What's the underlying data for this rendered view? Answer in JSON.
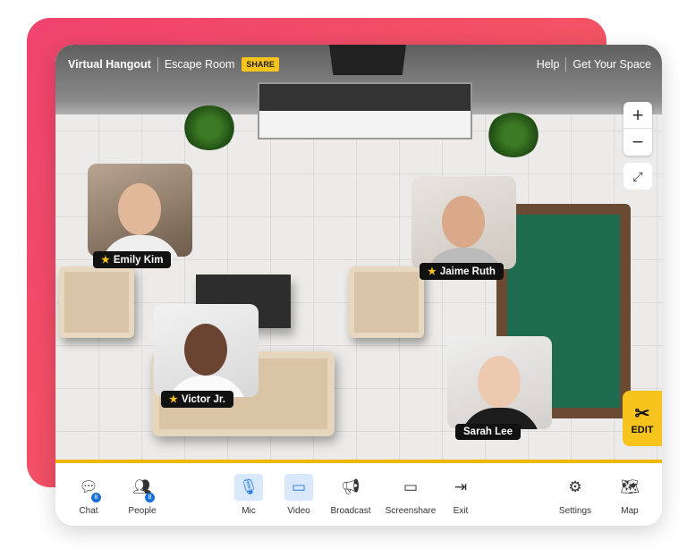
{
  "header": {
    "app_title": "Virtual Hangout",
    "room_name": "Escape Room",
    "share_label": "SHARE",
    "help_label": "Help",
    "get_space_label": "Get Your Space"
  },
  "participants": [
    {
      "name": "Emily Kim",
      "host": true
    },
    {
      "name": "Jaime Ruth",
      "host": true
    },
    {
      "name": "Victor Jr.",
      "host": true
    },
    {
      "name": "Sarah Lee",
      "host": false
    }
  ],
  "map_controls": {
    "zoom_in": "+",
    "zoom_out": "−",
    "fullscreen": "⤢"
  },
  "edit_label": "EDIT",
  "toolbar": {
    "chat": {
      "label": "Chat",
      "badge": "8"
    },
    "people": {
      "label": "People",
      "badge": "8"
    },
    "mic": {
      "label": "Mic",
      "active": true
    },
    "video": {
      "label": "Video",
      "active": true
    },
    "broadcast": {
      "label": "Broadcast"
    },
    "screenshare": {
      "label": "Screenshare"
    },
    "exit": {
      "label": "Exit"
    },
    "settings": {
      "label": "Settings"
    },
    "map": {
      "label": "Map"
    }
  },
  "colors": {
    "accent": "#f7c41d",
    "active_blue": "#2a7de1",
    "background_card": "#f0436e"
  }
}
